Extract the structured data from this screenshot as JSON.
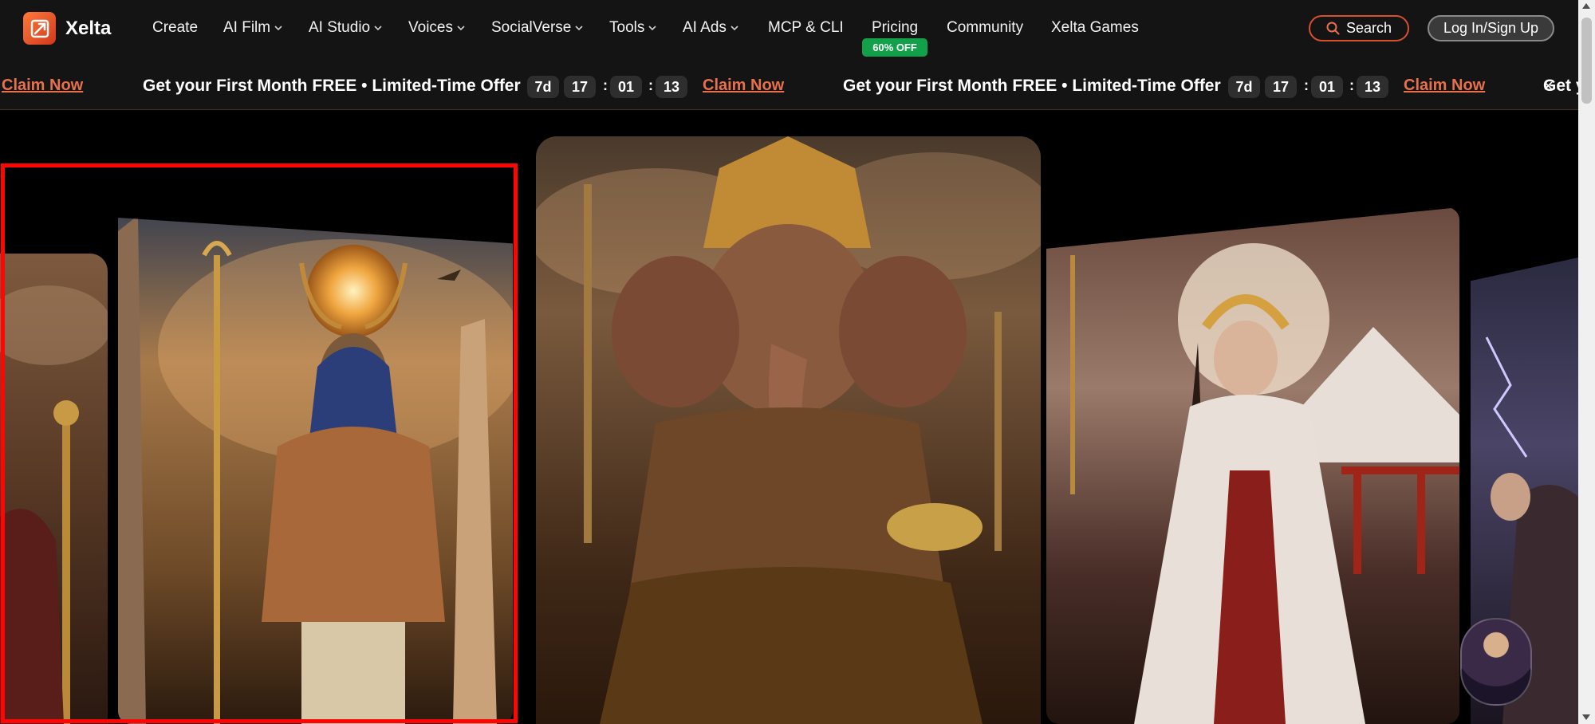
{
  "brand": {
    "name": "Xelta"
  },
  "nav": {
    "items": [
      {
        "label": "Create",
        "dropdown": false
      },
      {
        "label": "AI Film",
        "dropdown": true
      },
      {
        "label": "AI Studio",
        "dropdown": true
      },
      {
        "label": "Voices",
        "dropdown": true
      },
      {
        "label": "SocialVerse",
        "dropdown": true
      },
      {
        "label": "Tools",
        "dropdown": true
      },
      {
        "label": "AI Ads",
        "dropdown": true
      },
      {
        "label": "MCP & CLI",
        "dropdown": false
      },
      {
        "label": "Pricing",
        "dropdown": false
      },
      {
        "label": "Community",
        "dropdown": false
      },
      {
        "label": "Xelta Games",
        "dropdown": false
      }
    ],
    "pricing_badge": "60% OFF",
    "search_label": "Search",
    "login_label": "Log In/Sign Up"
  },
  "promo": {
    "claim_label": "Claim Now",
    "offer_text": "Get your First Month FREE • Limited-Time Offer",
    "partial_text": "Get y",
    "countdown": {
      "days": "7d",
      "hours": "17",
      "minutes": "01",
      "seconds": "13"
    },
    "close_label": "×"
  },
  "colors": {
    "accent": "#e8704a",
    "badge_green": "#12a04a",
    "selection_red": "#ff0505",
    "nav_bg": "#141414"
  },
  "carousel": {
    "cards": [
      {
        "subject": "robed figure with golden staff",
        "palette": "amber-storm"
      },
      {
        "subject": "falcon-headed deity with sun disc and staff",
        "palette": "golden-desert",
        "selected": true
      },
      {
        "subject": "elephant-headed deity on throne",
        "palette": "bronze-storm"
      },
      {
        "subject": "goddess in kimono with golden halo crown",
        "palette": "crimson-snow"
      },
      {
        "subject": "sorcerer with lightning",
        "palette": "violet-storm"
      }
    ]
  },
  "icons": {
    "logo": "xelta-logo-icon",
    "search": "search-icon",
    "chevron": "chevron-down-icon",
    "close": "close-icon"
  }
}
